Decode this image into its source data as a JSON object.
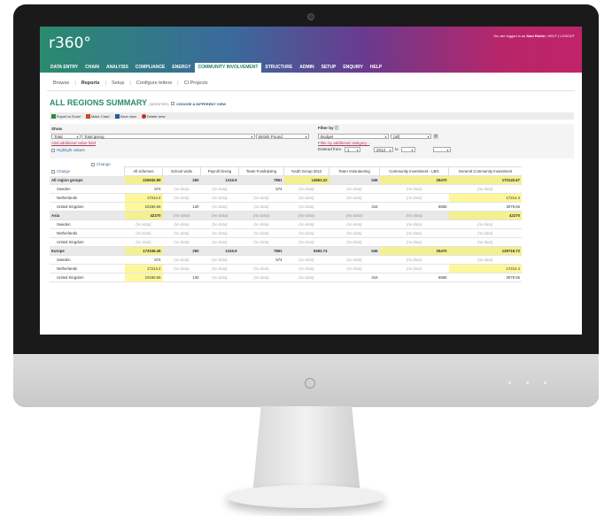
{
  "app": {
    "logo": "r360°",
    "user_text": "You are logged in as",
    "user_name": "Sam Robin",
    "help": "HELP",
    "logout": "LOGOUT"
  },
  "nav": [
    "DATA ENTRY",
    "CHAIN",
    "ANALYSIS",
    "COMPLIANCE",
    "ENERGY",
    "COMMUNITY INVOLVEMENT",
    "STRUCTURE",
    "ADMIN",
    "SETUP",
    "ENQUIRY",
    "HELP"
  ],
  "subnav": [
    "Browse",
    "Reports",
    "Setup",
    "Configure letters",
    "CI Projects"
  ],
  "page": {
    "title": "ALL REGIONS SUMMARY",
    "modified": "(MODIFIED)",
    "choose": "CHOOSE A DIFFERENT VIEW"
  },
  "toolbar": {
    "export": "Export to Excel",
    "chart": "Make Chart",
    "save": "Save view",
    "delete": "Delete view"
  },
  "filters": {
    "show_label": "Show",
    "show_value": "Total",
    "measure_value": "Total giving",
    "currency_value": "British Pound",
    "add_value": "Add additional value field",
    "highlight": "Highlight values",
    "filter_label": "Filter by",
    "filter_value": "Budget",
    "filter_op": "(all)",
    "filter_more": "Filter by additional category...",
    "entered_from": "Entered from",
    "from_month": "1",
    "from_year": "2013",
    "to_label": "to",
    "to_month": "",
    "to_year": ""
  },
  "table": {
    "change_label": "Change",
    "columns": [
      "All schemes",
      "School visits",
      "Payroll Giving",
      "Team Fundraising",
      "Youth Group 2012",
      "Team Volunteering",
      "Community Investment - LBG",
      "General Community Investment"
    ],
    "rows": [
      {
        "name": "All region groups",
        "group": true,
        "cells": [
          "226940.89",
          "260",
          "1316.9",
          "7861",
          "14863.22",
          "546",
          "25470",
          "170140.67"
        ]
      },
      {
        "name": "Sweden",
        "group": false,
        "cells": [
          "574",
          "(no data)",
          "(no data)",
          "574",
          "(no data)",
          "(no data)",
          "(no data)",
          "(no data)"
        ]
      },
      {
        "name": "Netherlands",
        "group": false,
        "cells": [
          "17214.4",
          "(no data)",
          "(no data)",
          "(no data)",
          "(no data)",
          "(no data)",
          "(no data)",
          "17214.4"
        ]
      },
      {
        "name": "United Kingdom",
        "group": false,
        "cells": [
          "10150.66",
          "130",
          "(no data)",
          "(no data)",
          "(no data)",
          "416",
          "6565",
          "3079.66"
        ]
      },
      {
        "name": "Asia",
        "group": true,
        "cells": [
          "42270",
          "(no data)",
          "(no data)",
          "(no data)",
          "(no data)",
          "(no data)",
          "(no data)",
          "42270"
        ]
      },
      {
        "name": "Sweden",
        "group": false,
        "cells": [
          "(no data)",
          "(no data)",
          "(no data)",
          "(no data)",
          "(no data)",
          "(no data)",
          "(no data)",
          "(no data)"
        ]
      },
      {
        "name": "Netherlands",
        "group": false,
        "cells": [
          "(no data)",
          "(no data)",
          "(no data)",
          "(no data)",
          "(no data)",
          "(no data)",
          "(no data)",
          "(no data)"
        ]
      },
      {
        "name": "United Kingdom",
        "group": false,
        "cells": [
          "(no data)",
          "(no data)",
          "(no data)",
          "(no data)",
          "(no data)",
          "(no data)",
          "(no data)",
          "(no data)"
        ]
      },
      {
        "name": "Europe",
        "group": true,
        "cells": [
          "173349.46",
          "260",
          "1316.9",
          "7861",
          "9493.74",
          "546",
          "25470",
          "129718.72"
        ]
      },
      {
        "name": "Sweden",
        "group": false,
        "cells": [
          "574",
          "(no data)",
          "(no data)",
          "574",
          "(no data)",
          "(no data)",
          "(no data)",
          "(no data)"
        ]
      },
      {
        "name": "Netherlands",
        "group": false,
        "cells": [
          "17214.4",
          "(no data)",
          "(no data)",
          "(no data)",
          "(no data)",
          "(no data)",
          "(no data)",
          "17214.4"
        ]
      },
      {
        "name": "United Kingdom",
        "group": false,
        "cells": [
          "10150.66",
          "130",
          "(no data)",
          "(no data)",
          "(no data)",
          "416",
          "6565",
          "3079.66"
        ]
      }
    ],
    "highlights": [
      [
        0,
        0
      ],
      [
        0,
        4
      ],
      [
        0,
        6
      ],
      [
        0,
        7
      ],
      [
        2,
        0
      ],
      [
        2,
        7
      ],
      [
        3,
        0
      ],
      [
        4,
        0
      ],
      [
        4,
        7
      ],
      [
        8,
        0
      ],
      [
        8,
        6
      ],
      [
        8,
        7
      ],
      [
        10,
        0
      ],
      [
        10,
        7
      ],
      [
        11,
        0
      ]
    ]
  },
  "colors": {
    "brand": "#2a8a6e",
    "highlight": "#fdf79a",
    "header_end": "#c0236a"
  }
}
